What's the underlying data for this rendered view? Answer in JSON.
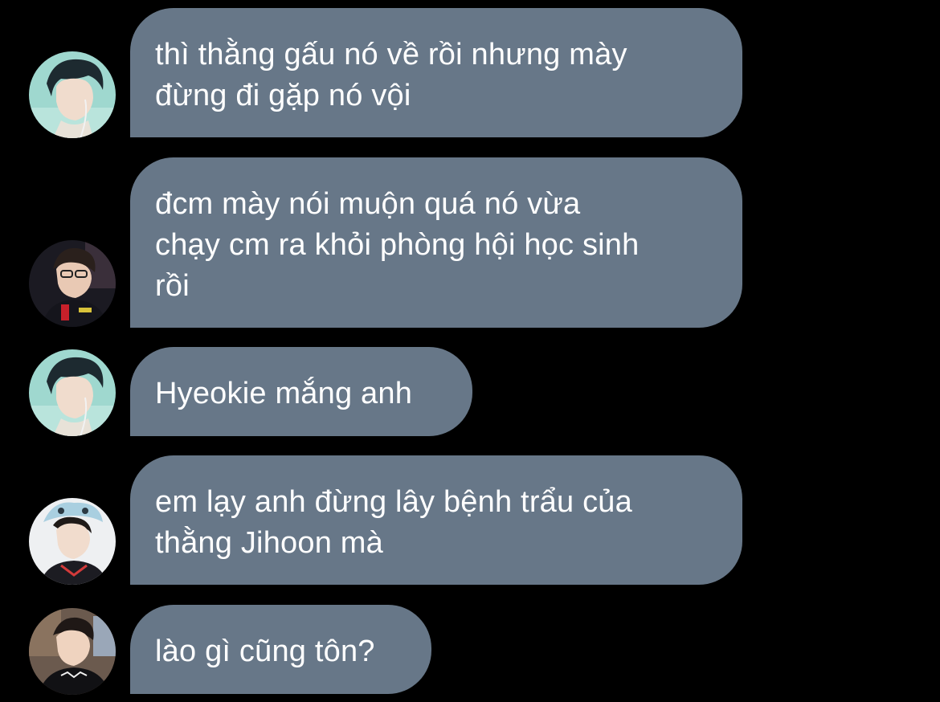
{
  "messages": [
    {
      "avatar": "avatar-user-a",
      "text": "thì thằng gấu nó về rồi nhưng mày\nđừng đi gặp nó vội"
    },
    {
      "avatar": "avatar-user-b",
      "text": "đcm mày nói muộn quá nó vừa\nchạy cm ra khỏi phòng hội học sinh\nrồi"
    },
    {
      "avatar": "avatar-user-a",
      "text": "Hyeokie mắng anh"
    },
    {
      "avatar": "avatar-user-c",
      "text": "em lạy anh đừng lây bệnh trẩu của\nthằng Jihoon mà"
    },
    {
      "avatar": "avatar-user-d",
      "text": "lào gì cũng tôn?"
    }
  ],
  "colors": {
    "background": "#000000",
    "bubble": "#677788",
    "text": "#ffffff"
  }
}
